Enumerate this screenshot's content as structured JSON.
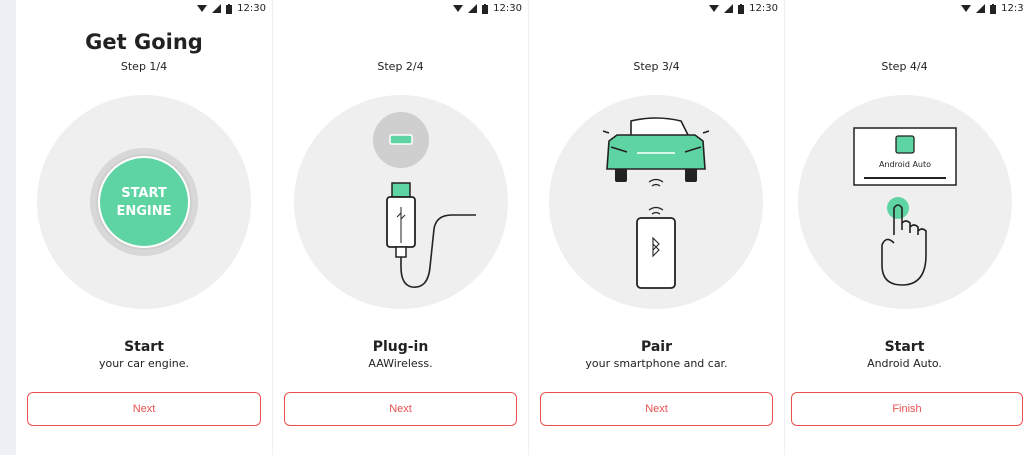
{
  "status_bar": {
    "time": "12:30"
  },
  "screens": [
    {
      "title": "Get Going",
      "step": "Step 1/4",
      "heading": "Start",
      "subtitle": "your car engine.",
      "button_label": "Next",
      "illustration": {
        "text_line1": "START",
        "text_line2": "ENGINE"
      }
    },
    {
      "title": "",
      "step": "Step 2/4",
      "heading": "Plug-in",
      "subtitle": "AAWireless.",
      "button_label": "Next"
    },
    {
      "title": "",
      "step": "Step 3/4",
      "heading": "Pair",
      "subtitle": "your smartphone and car.",
      "button_label": "Next"
    },
    {
      "title": "",
      "step": "Step 4/4",
      "heading": "Start",
      "subtitle": "Android Auto.",
      "button_label": "Finish",
      "illustration": {
        "screen_label": "Android Auto"
      }
    }
  ],
  "colors": {
    "accent_green": "#5dd4a2",
    "button_red": "#e9524f",
    "circle_gray": "#efefef",
    "page_bg": "#eef0f5"
  }
}
